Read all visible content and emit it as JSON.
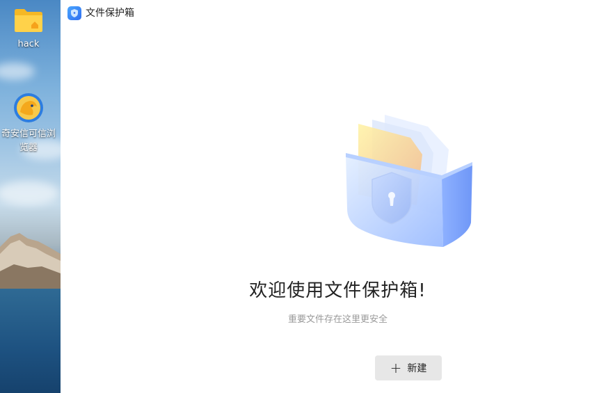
{
  "desktop": {
    "icons": [
      {
        "label": "hack",
        "icon": "folder-icon"
      },
      {
        "label": "奇安信可信浏览器",
        "icon": "browser-icon"
      }
    ]
  },
  "window": {
    "title": "文件保护箱",
    "app_icon": "shield-app-icon"
  },
  "main": {
    "welcome_title": "欢迎使用文件保护箱!",
    "welcome_subtitle": "重要文件存在这里更安全",
    "new_button": {
      "label": "新建",
      "icon": "plus-icon"
    }
  },
  "colors": {
    "accent": "#2f6ef0",
    "button_bg": "#e7e7e7",
    "subtitle": "#9a9a9a"
  }
}
